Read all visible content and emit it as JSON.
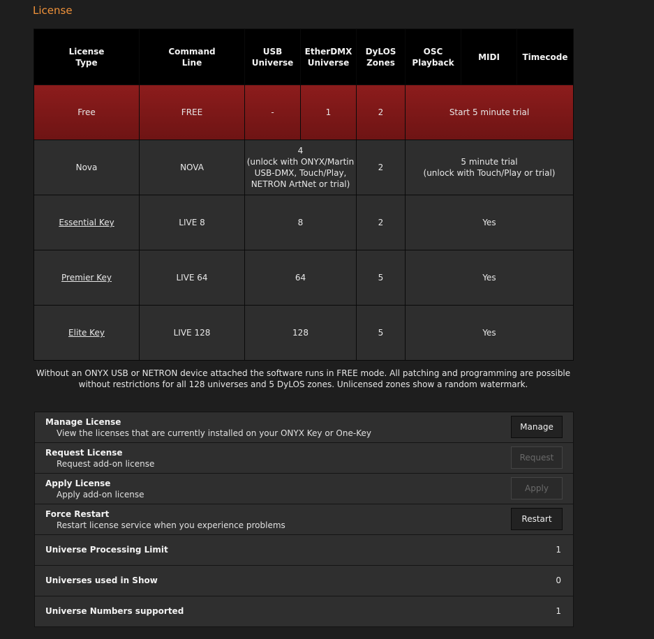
{
  "page": {
    "title": "License"
  },
  "table": {
    "headers": [
      "License\nType",
      "Command\nLine",
      "USB\nUniverse",
      "EtherDMX\nUniverse",
      "DyLOS\nZones",
      "OSC\nPlayback",
      "MIDI",
      "Timecode"
    ],
    "rows": {
      "free": {
        "type": "Free",
        "command": "FREE",
        "usb": "-",
        "etherdmx": "1",
        "dylos": "2",
        "trial": "Start 5 minute trial"
      },
      "nova": {
        "type": "Nova",
        "command": "NOVA",
        "universe": "4\n(unlock with ONYX/Martin\nUSB-DMX, Touch/Play,\nNETRON ArtNet or trial)",
        "dylos": "2",
        "features": "5 minute trial\n(unlock with Touch/Play or trial)"
      },
      "essential": {
        "type": "Essential Key",
        "command": "LIVE 8",
        "universe": "8",
        "dylos": "2",
        "features": "Yes"
      },
      "premier": {
        "type": "Premier Key",
        "command": "LIVE 64",
        "universe": "64",
        "dylos": "5",
        "features": "Yes"
      },
      "elite": {
        "type": "Elite Key",
        "command": "LIVE 128",
        "universe": "128",
        "dylos": "5",
        "features": "Yes"
      }
    }
  },
  "note": "Without an ONYX USB or NETRON device attached the software runs in FREE mode. All patching and programming are possible without restrictions for all 128 universes and 5 DyLOS zones. Unlicensed zones show a random watermark.",
  "settings": {
    "manage": {
      "title": "Manage License",
      "desc": "View the licenses that are currently installed on your ONYX Key or One-Key",
      "button": "Manage"
    },
    "request": {
      "title": "Request License",
      "desc": "Request add-on license",
      "button": "Request"
    },
    "apply": {
      "title": "Apply License",
      "desc": "Apply add-on license",
      "button": "Apply"
    },
    "restart": {
      "title": "Force Restart",
      "desc": "Restart license service when you experience problems",
      "button": "Restart"
    },
    "processing_limit": {
      "label": "Universe Processing Limit",
      "value": "1"
    },
    "used_in_show": {
      "label": "Universes used in Show",
      "value": "0"
    },
    "numbers_supported": {
      "label": "Universe Numbers supported",
      "value": "1"
    }
  },
  "colors": {
    "accent": "#f0923a",
    "free_row": "#7d1818",
    "background": "#1e1e1e"
  }
}
